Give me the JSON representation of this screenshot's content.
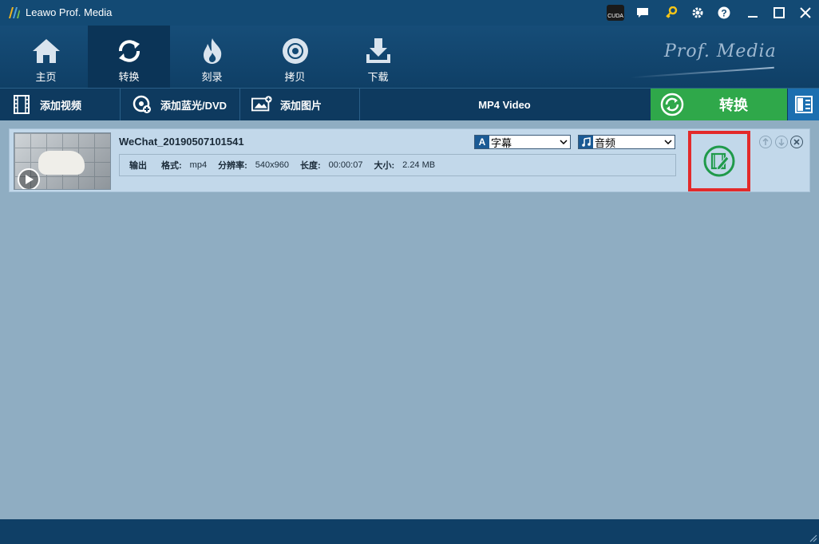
{
  "window": {
    "title": "Leawo Prof. Media"
  },
  "titlebar_icons": [
    "cuda-icon",
    "chat-icon",
    "key-icon",
    "gear-icon",
    "help-icon",
    "minimize-icon",
    "maximize-icon",
    "close-icon"
  ],
  "cuda_label": "CUDA",
  "nav": {
    "items": [
      {
        "label": "主页",
        "icon": "home-icon"
      },
      {
        "label": "转换",
        "icon": "convert-refresh-icon",
        "active": true
      },
      {
        "label": "刻录",
        "icon": "flame-icon"
      },
      {
        "label": "拷贝",
        "icon": "disc-icon"
      },
      {
        "label": "下载",
        "icon": "download-icon"
      }
    ],
    "brand": "Prof. Media"
  },
  "toolbar": {
    "add_video": "添加视频",
    "add_bluray": "添加蓝光/DVD",
    "add_image": "添加图片",
    "format": "MP4 Video",
    "convert": "转换"
  },
  "file": {
    "name": "WeChat_20190507101541",
    "subtitle_select": "字幕",
    "audio_select": "音频",
    "info": {
      "output_label": "输出",
      "format_label": "格式:",
      "format_value": "mp4",
      "resolution_label": "分辨率:",
      "resolution_value": "540x960",
      "duration_label": "长度:",
      "duration_value": "00:00:07",
      "size_label": "大小:",
      "size_value": "2.24 MB"
    }
  },
  "colors": {
    "titlebar": "#134a74",
    "convert_green": "#2fa84a",
    "main_bg": "#8fadc2",
    "row_bg": "#c2d8ea",
    "highlight_red": "#e32a2a"
  }
}
